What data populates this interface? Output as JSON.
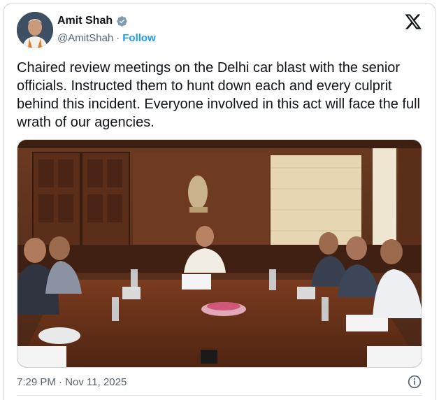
{
  "author": {
    "name": "Amit Shah",
    "handle": "@AmitShah",
    "separator": "·",
    "follow_label": "Follow",
    "verified": true
  },
  "tweet": {
    "text": "Chaired review meetings on the Delhi car blast with the senior officials. Instructed them to hunt down each and every culprit behind this incident. Everyone involved in this act will face the full wrath of our agencies."
  },
  "meta": {
    "timestamp": "7:29 PM · Nov 11, 2025"
  },
  "icons": {
    "verified": "verified-badge-icon",
    "platform": "x-logo-icon",
    "info": "info-icon"
  },
  "colors": {
    "accent": "#1d9bf0",
    "text": "#0f1419",
    "muted": "#536471"
  }
}
